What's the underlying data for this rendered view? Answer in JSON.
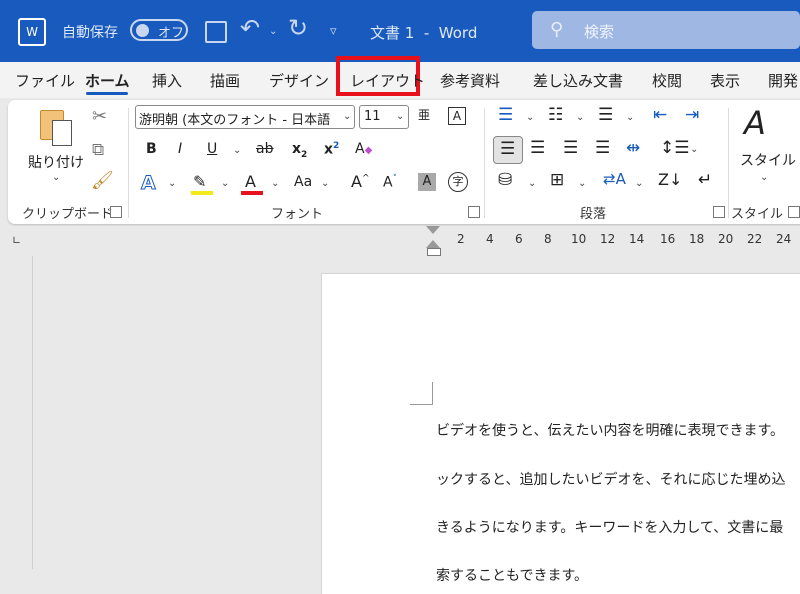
{
  "titlebar": {
    "autosave_label": "自動保存",
    "autosave_state": "オフ",
    "doc_title": "文書 1  -  Word",
    "search_placeholder": "検索"
  },
  "tabs": [
    {
      "label": "ファイル"
    },
    {
      "label": "ホーム",
      "active": true
    },
    {
      "label": "挿入"
    },
    {
      "label": "描画"
    },
    {
      "label": "デザイン"
    },
    {
      "label": "レイアウト",
      "highlighted": true
    },
    {
      "label": "参考資料"
    },
    {
      "label": "差し込み文書"
    },
    {
      "label": "校閲"
    },
    {
      "label": "表示"
    },
    {
      "label": "開発"
    }
  ],
  "ribbon": {
    "clipboard": {
      "paste_label": "貼り付け",
      "group_label": "クリップボード"
    },
    "font": {
      "font_name": "游明朝 (本文のフォント - 日本語",
      "font_size": "11",
      "group_label": "フォント"
    },
    "paragraph": {
      "group_label": "段落"
    },
    "styles": {
      "button_label": "スタイル",
      "group_label": "スタイル"
    }
  },
  "ruler": {
    "numbers": [
      "2",
      "4",
      "6",
      "8",
      "10",
      "12",
      "14",
      "16",
      "18",
      "20",
      "22",
      "24"
    ]
  },
  "document": {
    "lines": [
      "ビデオを使うと、伝えたい内容を明確に表現できます。",
      "ックすると、追加したいビデオを、それに応じた埋め込",
      "きるようになります。キーワードを入力して、文書に最",
      "索することもできます。"
    ]
  },
  "colors": {
    "titlebar": "#185abd",
    "highlight_box": "#e8101a",
    "accent": "#185abd"
  }
}
